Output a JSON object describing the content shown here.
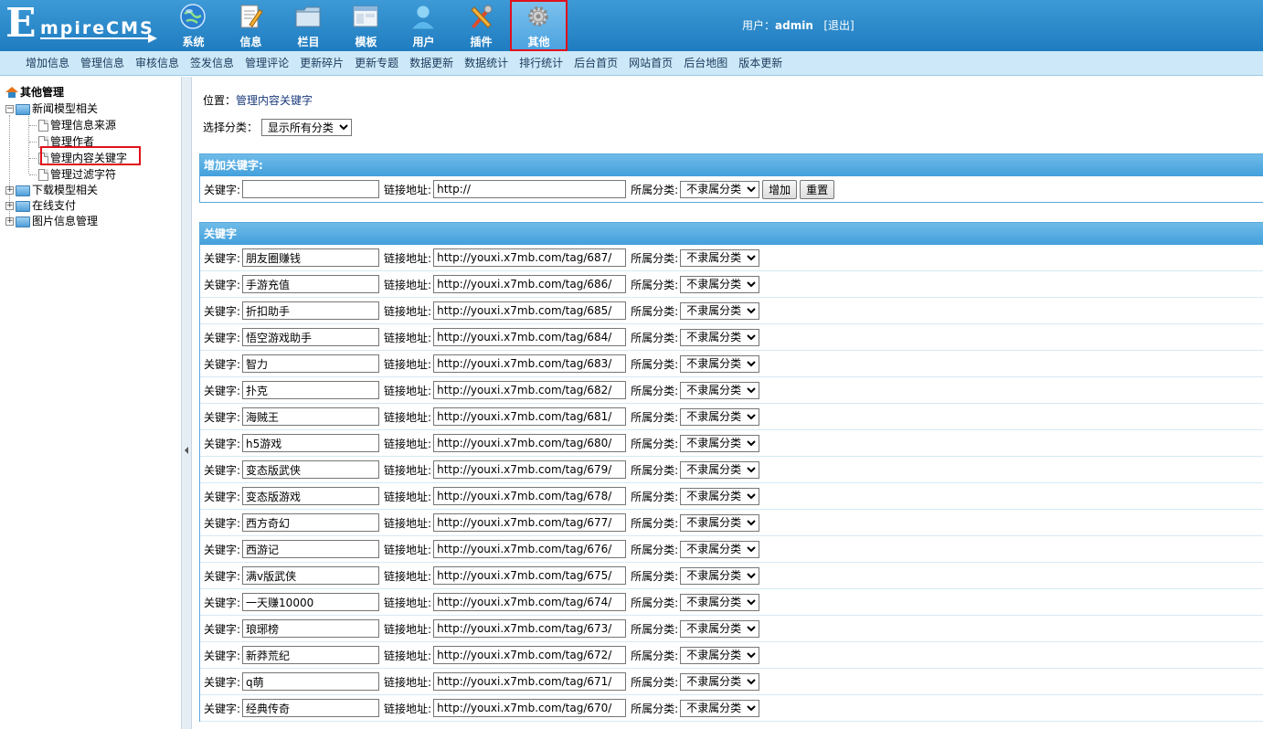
{
  "logo": {
    "letter": "E",
    "rest": "mpireCMS"
  },
  "topnav": [
    {
      "label": "系统",
      "icon": "globe-icon",
      "active": false
    },
    {
      "label": "信息",
      "icon": "notepad-icon",
      "active": false
    },
    {
      "label": "栏目",
      "icon": "folder-icon",
      "active": false
    },
    {
      "label": "模板",
      "icon": "window-icon",
      "active": false
    },
    {
      "label": "用户",
      "icon": "user-icon",
      "active": false
    },
    {
      "label": "插件",
      "icon": "tools-icon",
      "active": false
    },
    {
      "label": "其他",
      "icon": "gear-icon",
      "active": true
    }
  ],
  "user": {
    "prefix": "用户：",
    "name": "admin",
    "logout": "[退出]"
  },
  "menubar": [
    "增加信息",
    "管理信息",
    "审核信息",
    "签发信息",
    "管理评论",
    "更新碎片",
    "更新专题",
    "数据更新",
    "数据统计",
    "排行统计",
    "后台首页",
    "网站首页",
    "后台地图",
    "版本更新"
  ],
  "tree": {
    "root": "其他管理",
    "news_group": "新闻模型相关",
    "news_items": [
      "管理信息来源",
      "管理作者",
      "管理内容关键字",
      "管理过滤字符"
    ],
    "other_groups": [
      "下载模型相关",
      "在线支付",
      "图片信息管理"
    ]
  },
  "position": {
    "label": "位置：",
    "link": "管理内容关键字"
  },
  "category_select": {
    "label": "选择分类：",
    "value": "显示所有分类"
  },
  "add_panel": {
    "title": "增加关键字:",
    "keyword_label": "关键字:",
    "keyword_value": "",
    "url_label": "链接地址:",
    "url_value": "http://",
    "class_label": "所属分类:",
    "class_value": "不隶属分类",
    "add_button": "增加",
    "reset_button": "重置"
  },
  "list_panel": {
    "title": "关键字",
    "keyword_label": "关键字:",
    "url_label": "链接地址:",
    "class_label": "所属分类:",
    "class_value": "不隶属分类",
    "rows": [
      {
        "keyword": "朋友圈赚钱",
        "url": "http://youxi.x7mb.com/tag/687/"
      },
      {
        "keyword": "手游充值",
        "url": "http://youxi.x7mb.com/tag/686/"
      },
      {
        "keyword": "折扣助手",
        "url": "http://youxi.x7mb.com/tag/685/"
      },
      {
        "keyword": "悟空游戏助手",
        "url": "http://youxi.x7mb.com/tag/684/"
      },
      {
        "keyword": "智力",
        "url": "http://youxi.x7mb.com/tag/683/"
      },
      {
        "keyword": "扑克",
        "url": "http://youxi.x7mb.com/tag/682/"
      },
      {
        "keyword": "海贼王",
        "url": "http://youxi.x7mb.com/tag/681/"
      },
      {
        "keyword": "h5游戏",
        "url": "http://youxi.x7mb.com/tag/680/"
      },
      {
        "keyword": "变态版武侠",
        "url": "http://youxi.x7mb.com/tag/679/"
      },
      {
        "keyword": "变态版游戏",
        "url": "http://youxi.x7mb.com/tag/678/"
      },
      {
        "keyword": "西方奇幻",
        "url": "http://youxi.x7mb.com/tag/677/"
      },
      {
        "keyword": "西游记",
        "url": "http://youxi.x7mb.com/tag/676/"
      },
      {
        "keyword": "满v版武侠",
        "url": "http://youxi.x7mb.com/tag/675/"
      },
      {
        "keyword": "一天赚10000",
        "url": "http://youxi.x7mb.com/tag/674/"
      },
      {
        "keyword": "琅琊榜",
        "url": "http://youxi.x7mb.com/tag/673/"
      },
      {
        "keyword": "新莽荒纪",
        "url": "http://youxi.x7mb.com/tag/672/"
      },
      {
        "keyword": "q萌",
        "url": "http://youxi.x7mb.com/tag/671/"
      },
      {
        "keyword": "经典传奇",
        "url": "http://youxi.x7mb.com/tag/670/"
      }
    ]
  },
  "colors": {
    "header": "#1f7cc0",
    "menubar": "#cde8f8",
    "panel_head": "#43a0dc",
    "highlight": "#e0101a"
  }
}
